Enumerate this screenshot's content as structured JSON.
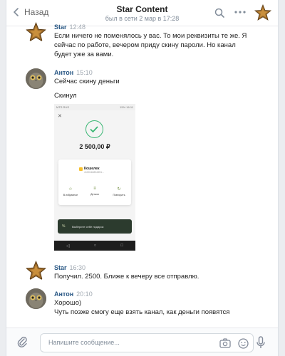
{
  "header": {
    "back_label": "Назад",
    "title": "Star Content",
    "subtitle": "был в сети 2 мар в 17:28"
  },
  "messages": [
    {
      "author": "Star",
      "time": "12:48",
      "lines": [
        "Если ничего не поменялось у вас. То мои реквизиты те же. Я",
        "сейчас по работе, вечером приду скину пароли. Но канал",
        "будет уже за вами."
      ]
    },
    {
      "author": "Антон",
      "time": "15:10",
      "lines": [
        "Сейчас скину деньги",
        "Скинул"
      ]
    },
    {
      "author": "Star",
      "time": "16:30",
      "lines": [
        "Получил. 2500. Ближе к вечеру все отправлю."
      ]
    },
    {
      "author": "Антон",
      "time": "20:10",
      "lines": [
        "Хорошо)",
        "Чуть позже смогу еще взять канал, как деньги появятся"
      ]
    }
  ],
  "attachment": {
    "status_left": "MTS RUS",
    "status_right": "15% 16:11",
    "amount": "2 500,00 ₽",
    "wallet_label": "Кошелек",
    "wallet_number": "4100116834351...",
    "actions": [
      "В избранное",
      "Детали",
      "Повторить"
    ],
    "gift_label": "Выберите себе подарок"
  },
  "composer": {
    "placeholder": "Напишите сообщение..."
  }
}
